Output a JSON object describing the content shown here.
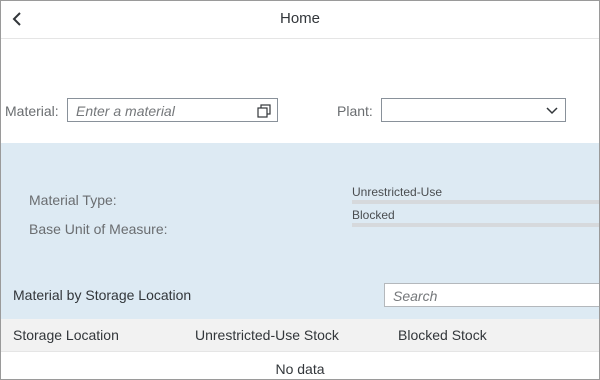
{
  "header": {
    "title": "Home",
    "back_icon": "chevron-left-icon"
  },
  "filters": {
    "material_label": "Material:",
    "material_placeholder": "Enter a material",
    "material_icon": "value-help-icon",
    "plant_label": "Plant:",
    "plant_value": "",
    "plant_icon": "chevron-down-icon"
  },
  "details": {
    "material_type_label": "Material Type:",
    "base_unit_label": "Base Unit of Measure:",
    "unrestricted_label": "Unrestricted-Use",
    "blocked_label": "Blocked"
  },
  "storage": {
    "title": "Material by Storage Location",
    "search_placeholder": "Search",
    "columns": [
      "Storage Location",
      "Unrestricted-Use Stock",
      "Blocked Stock"
    ],
    "no_data": "No data"
  },
  "colors": {
    "panel_bg": "#ddeaf3",
    "table_header_bg": "#f2f2f2"
  }
}
